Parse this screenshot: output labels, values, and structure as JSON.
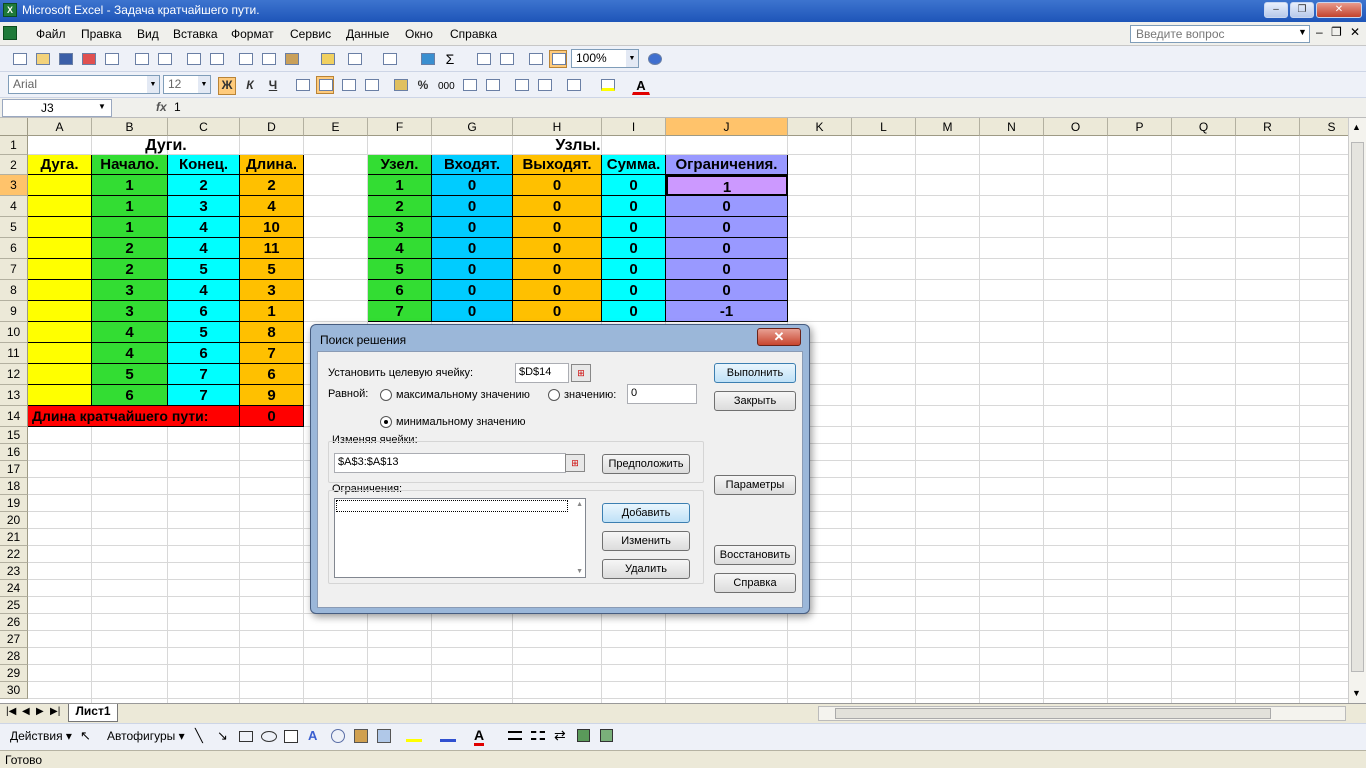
{
  "window": {
    "title": "Microsoft Excel - Задача кратчайшего пути.",
    "app_icon": "excel-icon"
  },
  "menu": {
    "items": [
      "Файл",
      "Правка",
      "Вид",
      "Вставка",
      "Формат",
      "Сервис",
      "Данные",
      "Окно",
      "Справка"
    ],
    "ask_placeholder": "Введите вопрос"
  },
  "toolbar": {
    "zoom": "100%",
    "font": "Arial",
    "font_size": "12"
  },
  "formula_bar": {
    "cell_ref": "J3",
    "fx": "fx",
    "value": "1"
  },
  "columns": [
    "A",
    "B",
    "C",
    "D",
    "E",
    "F",
    "G",
    "H",
    "I",
    "J",
    "K",
    "L",
    "M",
    "N",
    "O",
    "P",
    "Q",
    "R",
    "S"
  ],
  "rows": [
    "1",
    "2",
    "3",
    "4",
    "5",
    "6",
    "7",
    "8",
    "9",
    "10",
    "11",
    "12",
    "13",
    "14",
    "15",
    "16",
    "17",
    "18",
    "19",
    "20",
    "21",
    "22",
    "23",
    "24",
    "25",
    "26",
    "27",
    "28",
    "29",
    "30"
  ],
  "arcs": {
    "title": "Дуги.",
    "headers": [
      "Дуга.",
      "Начало.",
      "Конец.",
      "Длина."
    ],
    "start": [
      "1",
      "1",
      "1",
      "2",
      "2",
      "3",
      "3",
      "4",
      "4",
      "5",
      "6"
    ],
    "end": [
      "2",
      "3",
      "4",
      "4",
      "5",
      "4",
      "6",
      "5",
      "6",
      "7",
      "7"
    ],
    "length": [
      "2",
      "4",
      "10",
      "11",
      "5",
      "3",
      "1",
      "8",
      "7",
      "6",
      "9"
    ],
    "total_label": "Длина кратчайшего пути:",
    "total_value": "0"
  },
  "nodes": {
    "title": "Узлы.",
    "headers": [
      "Узел.",
      "Входят.",
      "Выходят.",
      "Сумма.",
      "Ограничения."
    ],
    "ids": [
      "1",
      "2",
      "3",
      "4",
      "5",
      "6",
      "7"
    ],
    "incoming": [
      "0",
      "0",
      "0",
      "0",
      "0",
      "0",
      "0"
    ],
    "outgoing": [
      "0",
      "0",
      "0",
      "0",
      "0",
      "0",
      "0"
    ],
    "sum": [
      "0",
      "0",
      "0",
      "0",
      "0",
      "0",
      "0"
    ],
    "constraints": [
      "1",
      "0",
      "0",
      "0",
      "0",
      "0",
      "-1"
    ]
  },
  "colors": {
    "yellow": "#ffff00",
    "green": "#33dd33",
    "cyan": "#00ffff",
    "orange": "#ffc000",
    "sky": "#00ccff",
    "violet": "#9999ff",
    "red": "#ff0000",
    "selected": "#cc99ff"
  },
  "sheet_tab": "Лист1",
  "drawing_toolbar": {
    "actions": "Действия",
    "autoshapes": "Автофигуры"
  },
  "status": "Готово",
  "solver": {
    "title": "Поиск решения",
    "target_label": "Установить целевую ячейку:",
    "target_value": "$D$14",
    "equal_label": "Равной:",
    "opt_max": "максимальному значению",
    "opt_value": "значению:",
    "value_field": "0",
    "opt_min": "минимальному значению",
    "changing_label": "Изменяя ячейки:",
    "changing_value": "$A$3:$A$13",
    "guess": "Предположить",
    "constraints_label": "Ограничения:",
    "add": "Добавить",
    "change": "Изменить",
    "delete": "Удалить",
    "solve": "Выполнить",
    "close": "Закрыть",
    "options": "Параметры",
    "reset": "Восстановить",
    "help": "Справка"
  }
}
